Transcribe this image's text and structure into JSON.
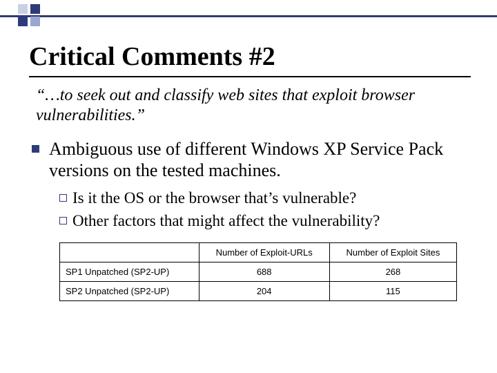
{
  "title": "Critical Comments #2",
  "quote": "“…to seek out and classify web sites that exploit browser vulnerabilities.”",
  "bullets": {
    "main": "Ambiguous use of different Windows XP Service Pack versions on the tested machines.",
    "sub1": "Is it the OS or the browser that’s vulnerable?",
    "sub2": "Other factors that might affect the vulnerability?"
  },
  "table": {
    "headers": {
      "blank": "",
      "c1": "Number of Exploit-URLs",
      "c2": "Number of Exploit Sites"
    },
    "rows": [
      {
        "label": "SP1 Unpatched (SP2-UP)",
        "c1": "688",
        "c2": "268"
      },
      {
        "label": "SP2 Unpatched (SP2-UP)",
        "c1": "204",
        "c2": "115"
      }
    ]
  },
  "chart_data": {
    "type": "table",
    "columns": [
      "",
      "Number of Exploit-URLs",
      "Number of Exploit Sites"
    ],
    "rows": [
      [
        "SP1 Unpatched (SP2-UP)",
        688,
        268
      ],
      [
        "SP2 Unpatched (SP2-UP)",
        204,
        115
      ]
    ]
  }
}
